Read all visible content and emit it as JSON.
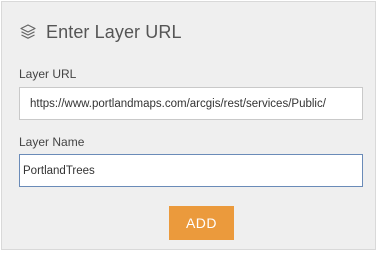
{
  "dialog": {
    "title": "Enter Layer URL",
    "icon": "layers-icon"
  },
  "layer_url": {
    "label": "Layer URL",
    "value": "https://www.portlandmaps.com/arcgis/rest/services/Public/"
  },
  "layer_name": {
    "label": "Layer Name",
    "value": "PortlandTrees"
  },
  "add_button": {
    "label": "ADD",
    "color": "#eb9a3c"
  }
}
